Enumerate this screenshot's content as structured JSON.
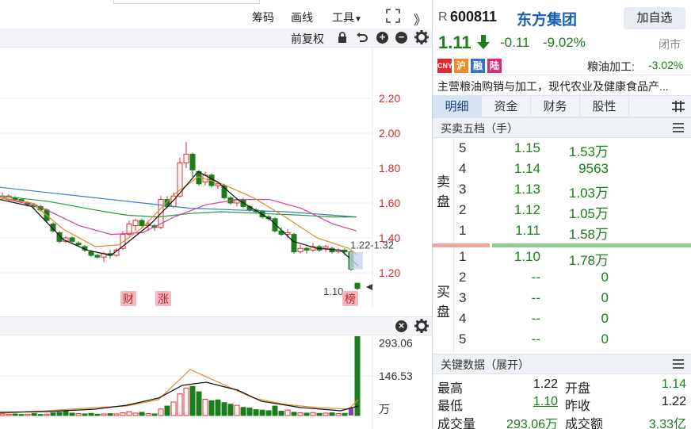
{
  "toolbar": {
    "chip": "筹码",
    "draw": "画线",
    "tools": "工具",
    "adjust": "前复权",
    "expand_arrows": "》"
  },
  "kline": {
    "price_ticks": [
      "2.20",
      "2.00",
      "1.80",
      "1.60",
      "1.40",
      "1.20"
    ],
    "range_label": "1.22-1.32",
    "last_label": "1.10→",
    "markers": [
      "财",
      "涨",
      "榜"
    ]
  },
  "volume": {
    "ticks": [
      "293.06",
      "146.53",
      "万"
    ]
  },
  "stock": {
    "prefix": "R",
    "code": "600811",
    "name": "东方集团",
    "add_watch": "加自选",
    "price": "1.11",
    "change": "-0.11",
    "change_pct": "-9.02%",
    "status": "闭市",
    "tags": [
      "CNY",
      "沪",
      "融",
      "陆"
    ],
    "sector_label": "粮油加工:",
    "sector_change": "-3.02%",
    "description": "主营粮油购销与加工，现代农业及健康食品产..."
  },
  "tabs": [
    "明细",
    "资金",
    "财务",
    "股性"
  ],
  "orderbook": {
    "title": "买卖五档（手）",
    "sell_label": [
      "卖",
      "盘"
    ],
    "buy_label": [
      "买",
      "盘"
    ],
    "asks": [
      {
        "level": "5",
        "price": "1.15",
        "vol": "1.53万"
      },
      {
        "level": "4",
        "price": "1.14",
        "vol": "9563"
      },
      {
        "level": "3",
        "price": "1.13",
        "vol": "1.03万"
      },
      {
        "level": "2",
        "price": "1.12",
        "vol": "1.05万"
      },
      {
        "level": "1",
        "price": "1.11",
        "vol": "1.58万"
      }
    ],
    "bids": [
      {
        "level": "1",
        "price": "1.10",
        "vol": "1.78万"
      },
      {
        "level": "2",
        "price": "--",
        "vol": "0"
      },
      {
        "level": "3",
        "price": "--",
        "vol": "0"
      },
      {
        "level": "4",
        "price": "--",
        "vol": "0"
      },
      {
        "level": "5",
        "price": "--",
        "vol": "0"
      }
    ]
  },
  "key_data": {
    "title": "关键数据（展开）",
    "high_label": "最高",
    "high": "1.22",
    "open_label": "开盘",
    "open": "1.14",
    "low_label": "最低",
    "low": "1.10",
    "prev_label": "昨收",
    "prev": "1.22",
    "vol_label": "成交量",
    "vol": "293.06万",
    "amt_label": "成交额",
    "amt": "3.33亿"
  },
  "colors": {
    "up": "#e0282e",
    "down": "#1b7d1b",
    "accent": "#1a5fb4"
  }
}
